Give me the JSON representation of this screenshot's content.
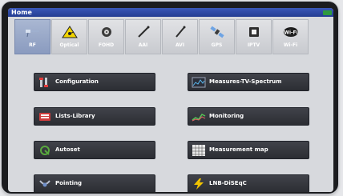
{
  "window": {
    "title": "Home",
    "status_lines": [
      "",
      ""
    ]
  },
  "tabs": [
    {
      "label": "RF",
      "icon": "antenna-icon",
      "active": true
    },
    {
      "label": "Optical",
      "icon": "warning-laser-icon",
      "active": false
    },
    {
      "label": "FOHD",
      "icon": "optical-fiber-icon",
      "active": false
    },
    {
      "label": "AAI",
      "icon": "probe-icon",
      "active": false
    },
    {
      "label": "AVI",
      "icon": "probe-icon",
      "active": false
    },
    {
      "label": "GPS",
      "icon": "satellite-icon",
      "active": false
    },
    {
      "label": "IPTV",
      "icon": "network-port-icon",
      "active": false
    },
    {
      "label": "Wi-Fi",
      "icon": "wifi-icon",
      "active": false
    }
  ],
  "menu": {
    "left": [
      {
        "label": "Configuration",
        "icon": "tools-icon"
      },
      {
        "label": "Lists-Library",
        "icon": "library-icon"
      },
      {
        "label": "Autoset",
        "icon": "autoset-icon"
      },
      {
        "label": "Pointing",
        "icon": "dish-pointing-icon"
      }
    ],
    "right": [
      {
        "label": "Measures-TV-Spectrum",
        "icon": "spectrum-icon"
      },
      {
        "label": "Monitoring",
        "icon": "monitoring-icon"
      },
      {
        "label": "Measurement map",
        "icon": "map-grid-icon"
      },
      {
        "label": "LNB-DiSEqC",
        "icon": "lightning-icon"
      }
    ]
  }
}
